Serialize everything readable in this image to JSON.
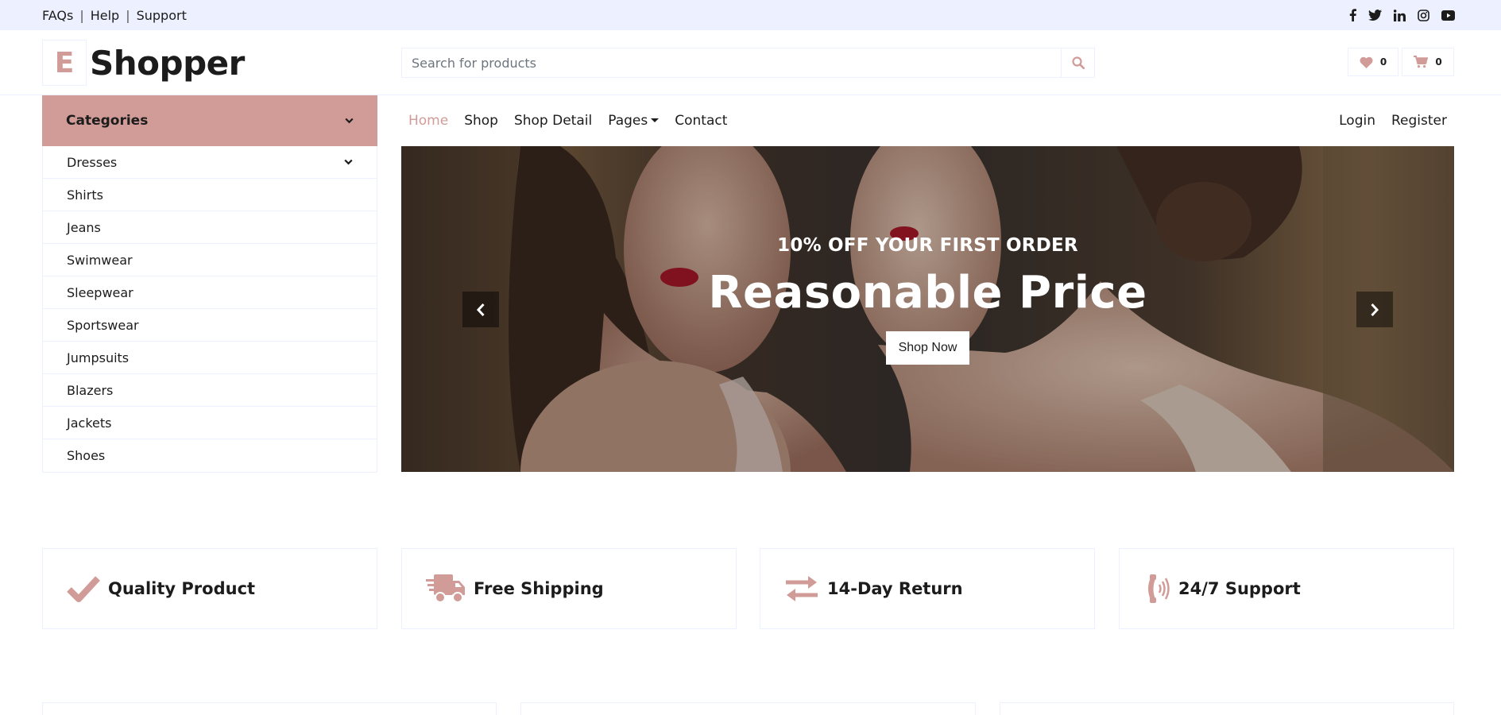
{
  "topbar": {
    "links": [
      "FAQs",
      "Help",
      "Support"
    ],
    "separator": "|",
    "social": [
      "facebook-icon",
      "twitter-icon",
      "linkedin-icon",
      "instagram-icon",
      "youtube-icon"
    ]
  },
  "header": {
    "logo_letter": "E",
    "logo_text": "Shopper",
    "search_placeholder": "Search for products",
    "wishlist_count": "0",
    "cart_count": "0"
  },
  "categories": {
    "title": "Categories",
    "items": [
      "Dresses",
      "Shirts",
      "Jeans",
      "Swimwear",
      "Sleepwear",
      "Sportswear",
      "Jumpsuits",
      "Blazers",
      "Jackets",
      "Shoes"
    ]
  },
  "nav": {
    "items": [
      "Home",
      "Shop",
      "Shop Detail",
      "Pages",
      "Contact"
    ],
    "active": "Home",
    "right": [
      "Login",
      "Register"
    ]
  },
  "hero": {
    "subtitle": "10% OFF YOUR FIRST ORDER",
    "title": "Reasonable Price",
    "button": "Shop Now"
  },
  "features": [
    {
      "icon": "check-icon",
      "label": "Quality Product"
    },
    {
      "icon": "shipping-truck-icon",
      "label": "Free Shipping"
    },
    {
      "icon": "exchange-arrows-icon",
      "label": "14-Day Return"
    },
    {
      "icon": "phone-volume-icon",
      "label": "24/7 Support"
    }
  ],
  "colors": {
    "primary": "#d19c97",
    "secondary": "#edf1ff",
    "dark": "#1c1c1c"
  }
}
